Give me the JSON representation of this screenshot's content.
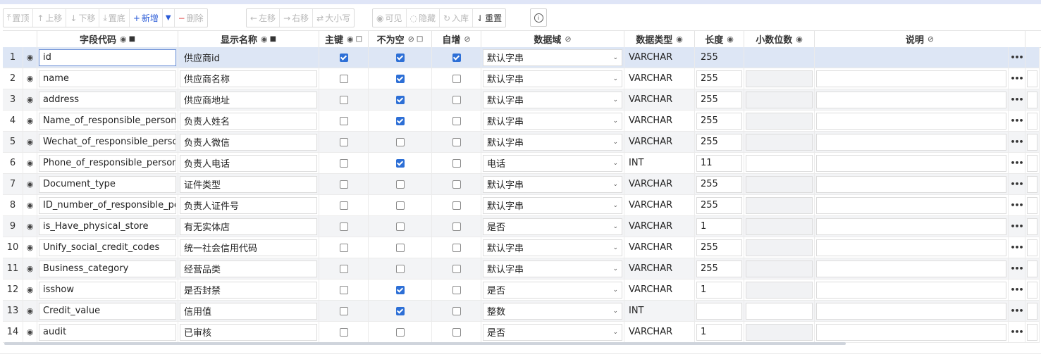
{
  "toolbar": {
    "buttons": [
      {
        "label": "置顶",
        "icon": "⤒"
      },
      {
        "label": "上移",
        "icon": "↑"
      },
      {
        "label": "下移",
        "icon": "↓"
      },
      {
        "label": "置底",
        "icon": "⤓"
      },
      {
        "label": "新增",
        "icon": "+"
      },
      {
        "label": "▼",
        "icon": ""
      },
      {
        "label": "删除",
        "icon": "−"
      },
      {
        "label": "左移",
        "icon": "←"
      },
      {
        "label": "右移",
        "icon": "→"
      },
      {
        "label": "大小写",
        "icon": "⇄"
      },
      {
        "label": "可见",
        "icon": "◉"
      },
      {
        "label": "隐藏",
        "icon": "◌"
      },
      {
        "label": "入库",
        "icon": "↻"
      },
      {
        "label": "重置",
        "icon": "⇃"
      }
    ],
    "info_label": "i"
  },
  "columns": {
    "code": "字段代码",
    "display": "显示名称",
    "pk": "主键",
    "not_null": "不为空",
    "auto_inc": "自增",
    "domain": "数据域",
    "data_type": "数据类型",
    "length": "长度",
    "decimals": "小数位数",
    "desc": "说明"
  },
  "icons": {
    "eye": "eye-icon",
    "lock": "lock-icon",
    "unlock": "unlock-icon",
    "more": "more-icon",
    "chevron": "chevron-down-icon"
  },
  "more_label": "•••",
  "rows": [
    {
      "num": "1",
      "code": "id",
      "display": "供应商id",
      "pk": true,
      "nn": true,
      "ai": true,
      "domain": "默认字串",
      "type": "VARCHAR",
      "length": "255"
    },
    {
      "num": "2",
      "code": "name",
      "display": "供应商名称",
      "pk": false,
      "nn": true,
      "ai": false,
      "domain": "默认字串",
      "type": "VARCHAR",
      "length": "255"
    },
    {
      "num": "3",
      "code": "address",
      "display": "供应商地址",
      "pk": false,
      "nn": true,
      "ai": false,
      "domain": "默认字串",
      "type": "VARCHAR",
      "length": "255"
    },
    {
      "num": "4",
      "code": "Name_of_responsible_person",
      "display": "负责人姓名",
      "pk": false,
      "nn": true,
      "ai": false,
      "domain": "默认字串",
      "type": "VARCHAR",
      "length": "255"
    },
    {
      "num": "5",
      "code": "Wechat_of_responsible_person",
      "display": "负责人微信",
      "pk": false,
      "nn": false,
      "ai": false,
      "domain": "默认字串",
      "type": "VARCHAR",
      "length": "255"
    },
    {
      "num": "6",
      "code": "Phone_of_responsible_person",
      "display": "负责人电话",
      "pk": false,
      "nn": true,
      "ai": false,
      "domain": "电话",
      "type": "INT",
      "length": "11"
    },
    {
      "num": "7",
      "code": "Document_type",
      "display": "证件类型",
      "pk": false,
      "nn": false,
      "ai": false,
      "domain": "默认字串",
      "type": "VARCHAR",
      "length": "255"
    },
    {
      "num": "8",
      "code": "ID_number_of_responsible_person",
      "display": "负责人证件号",
      "pk": false,
      "nn": false,
      "ai": false,
      "domain": "默认字串",
      "type": "VARCHAR",
      "length": "255"
    },
    {
      "num": "9",
      "code": "is_Have_physical_store",
      "display": "有无实体店",
      "pk": false,
      "nn": false,
      "ai": false,
      "domain": "是否",
      "type": "VARCHAR",
      "length": "1"
    },
    {
      "num": "10",
      "code": "Unify_social_credit_codes",
      "display": "统一社会信用代码",
      "pk": false,
      "nn": false,
      "ai": false,
      "domain": "默认字串",
      "type": "VARCHAR",
      "length": "255"
    },
    {
      "num": "11",
      "code": "Business_category",
      "display": "经营品类",
      "pk": false,
      "nn": false,
      "ai": false,
      "domain": "默认字串",
      "type": "VARCHAR",
      "length": "255"
    },
    {
      "num": "12",
      "code": "isshow",
      "display": "是否封禁",
      "pk": false,
      "nn": true,
      "ai": false,
      "domain": "是否",
      "type": "VARCHAR",
      "length": "1"
    },
    {
      "num": "13",
      "code": "Credit_value",
      "display": "信用值",
      "pk": false,
      "nn": true,
      "ai": false,
      "domain": "整数",
      "type": "INT",
      "length": ""
    },
    {
      "num": "14",
      "code": "audit",
      "display": "已审核",
      "pk": false,
      "nn": false,
      "ai": false,
      "domain": "是否",
      "type": "VARCHAR",
      "length": "1"
    }
  ]
}
